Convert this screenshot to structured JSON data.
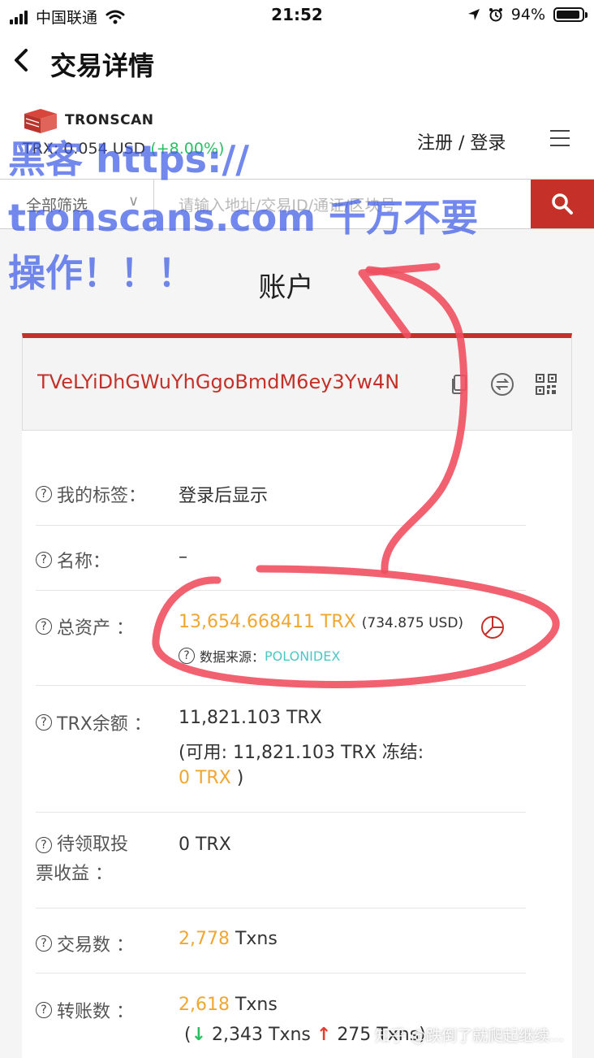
{
  "status_bar": {
    "carrier": "中国联通",
    "time": "21:52",
    "battery": "94%",
    "battery_level": 0.94
  },
  "nav": {
    "back_icon": "chevron-left-icon",
    "title": "交易详情"
  },
  "site_header": {
    "logo_text": "TRONSCAN",
    "price_label": "TRX: 0.054 USD",
    "price_change": "(+8.00%)",
    "auth_text": "注册 / 登录",
    "menu_icon": "hamburger-icon"
  },
  "search": {
    "filter_label": "全部筛选",
    "placeholder": "请输入地址/交易ID/通证/区块号",
    "search_icon": "search-icon"
  },
  "page_title": "账户",
  "account": {
    "address": "TVeLYiDhGWuYhGgoBmdM6ey3Yw4N",
    "accent_color": "#c53028"
  },
  "rows": {
    "tag": {
      "label": "我的标签：",
      "value": "登录后显示"
    },
    "name": {
      "label": "名称：",
      "value": "–"
    },
    "assets": {
      "label": "总资产 ：",
      "amount": "13,654.668411 TRX",
      "usd": "(734.875 USD)",
      "source_label": "数据来源：",
      "source_value": "POLONIDEX"
    },
    "trx_balance": {
      "label": "TRX余额 ：",
      "line1": "11,821.103 TRX",
      "line2": "(可用: 11,821.103 TRX  冻结:",
      "frozen": "0 TRX",
      "close": " )"
    },
    "reward": {
      "label_line1": "待领取投",
      "label_line2": "票收益 ：",
      "value": "0 TRX"
    },
    "txns": {
      "label": "交易数 ：",
      "count": "2,778",
      "unit": " Txns"
    },
    "transfers": {
      "label": "转账数 ：",
      "count": "2,618",
      "unit": " Txns",
      "in_count": "2,343 Txns",
      "out_count": "275 Txns",
      "close": ")"
    }
  },
  "overlay": {
    "line1": "黑客 https://",
    "line2": "tronscans.com 千万不要",
    "line3": "操作！！！",
    "color": "#3c5ae6",
    "stroke_color": "#f0505f"
  },
  "watermark": "知乎 @跌倒了就爬起继续..."
}
